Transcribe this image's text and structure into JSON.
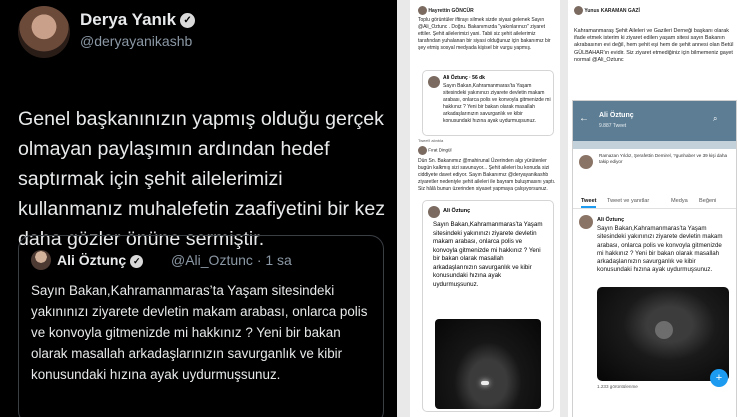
{
  "main_tweet": {
    "author_name": "Derya Yanık",
    "author_handle": "@deryayanikashb",
    "verified_badge": "✓",
    "text": "Genel başkanınızın yapmış olduğu gerçek olmayan paylaşımın ardından hedef saptırmak için şehit ailelerimizi kullanmanız muhalefetin zaafiyetini bir kez daha gözler önüne sermiştir.",
    "quoted": {
      "author_name": "Ali Öztunç",
      "author_handle": "@Ali_Oztunc",
      "time": "· 1 sa",
      "text": "Sayın Bakan,Kahramanmaras’ta Yaşam sitesindeki yakınınızı ziyarete devletin makam arabası, onlarca polis ve konvoyla gitmenizde mi hakkınız ? Yeni  bir bakan olarak masallah arkadaşlarınızın savurganlık ve kibir konusundaki hızına ayak uydurmuşsunuz."
    }
  },
  "middle_screenshot": {
    "header_name": "Hayrettin GÖNCÜR",
    "intro_text": "Toplu görüntüler iftirayı silmek sizde siyasi gelenek Sayın @Ali_Oztunc . Doğru. Bakanımızda \"yakınlarınızı\" ziyaret ettiler. Şehit ailelerimizi yani. Tabii siz şehit ailelerimiz tarafından yuhalanan bir siyasi olduğunuz için bakanımız bir şey etmiş sosyal medyada kişisel bir vurgu yapmış.",
    "quote_card": {
      "author": "Ali Öztunç · 56 dk",
      "text": "Sayın Bakan,Kahramanmaras’ta Yaşam sitesindeki yakınınızı ziyarete devletin makam arabası, onlarca polis ve konvoyla gitmenizde mi hakkınız ? Yeni bir bakan olarak masallah arkadaşlarınızın savurganlık ve kibir konusundaki hızına ayak uydurmuşsunuz."
    },
    "separator": "Tweet'i alıntıla",
    "second_header": "Fırat Dingül",
    "second_text": "Dün Sn. Bakanımız @mahirunal Üzerinden algı yürütenler bugün kalkmış sizi savunuyor... Şehit aileleri bu konuda sizi ciddiyete davet ediyor. Sayın Bakanımız @deryayanikashb ziyaretler nedeniyle şehit aileleri ile bayram buluşmasını yaptı. Siz hâlâ bunun üzerinden siyaset yapmaya çalışıyorsunuz.",
    "second_card": {
      "author": "Ali Öztunç",
      "text": "Sayın Bakan,Kahramanmaras’ta Yaşam sitesindeki yakınınızı ziyarete devletin makam arabası, onlarca polis ve konvoyla gitmenizde mi hakkınız ? Yeni bir bakan olarak masallah arkadaşlarınızın savurganlık ve kibir konusundaki hızına ayak uydurmuşsunuz."
    }
  },
  "right_screenshot": {
    "header_name": "Yunus KARAMAN GAZİ",
    "intro_text": "Kahramanmaraş Şehit Aileleri ve Gazileri Derneği başkanı olarak ifade etmek isterim ki ziyaret edilen yaşam sitesi sayın Bakanın akrabasının evi değil, hem şehit eşi hem de şehit annesi olan Betül GÜLBAHAR'ın evidir. Siz ziyaret etmediğiniz için bilmemeniz gayet normal @Ali_Oztunc",
    "profile": {
      "name": "Ali Öztunç",
      "count": "9.887 Tweet",
      "back": "←",
      "search": "⌕"
    },
    "mini_text": "Ramazan Yıldız, Şerafettin Demirel, ?gunhaber ve 39 kişi daha takip ediyor",
    "tabs": [
      "Tweet",
      "Tweet ve yanıtlar",
      "Medya",
      "Beğeni"
    ],
    "tweet_author": "Ali Öztunç",
    "tweet_text": "Sayın Bakan,Kahramanmaras’ta Yaşam sitesindeki yakınınızı ziyarete devletin makam arabası, onlarca polis ve konvoyla gitmenizde mi hakkınız ? Yeni bir bakan olarak masallah arkadaşlarınızın savurganlık ve kibir konusundaki hızına ayak uydurmuşsunuz.",
    "views": "1.233 görüntülenme",
    "fab": "+"
  }
}
